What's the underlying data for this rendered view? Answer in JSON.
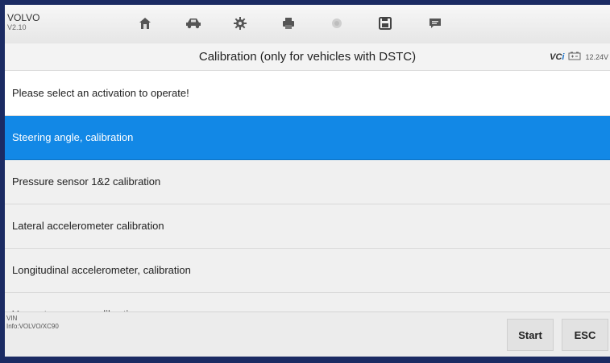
{
  "header": {
    "make": "VOLVO",
    "version": "V2.10",
    "toolbar_icons": [
      "home-icon",
      "car-icon",
      "gear-icon",
      "printer-icon",
      "record-icon",
      "save-icon",
      "message-icon"
    ]
  },
  "titlebar": {
    "title": "Calibration (only for vehicles with DSTC)",
    "vci_label_a": "VC",
    "vci_label_b": "i",
    "battery_voltage": "12.24V"
  },
  "list": {
    "prompt": "Please select an activation to operate!",
    "items": [
      {
        "label": "Steering angle, calibration",
        "selected": true
      },
      {
        "label": "Pressure sensor 1&2 calibration",
        "selected": false
      },
      {
        "label": "Lateral accelerometer calibration",
        "selected": false
      },
      {
        "label": "Longitudinal accelerometer, calibration",
        "selected": false
      },
      {
        "label": "Yaw rate sensor, calibration",
        "selected": false
      }
    ]
  },
  "footer": {
    "vin_label": "VIN",
    "info": "Info:VOLVO/XC90",
    "start_label": "Start",
    "esc_label": "ESC"
  },
  "colors": {
    "accent": "#1288e6",
    "frame": "#1b2b63"
  }
}
